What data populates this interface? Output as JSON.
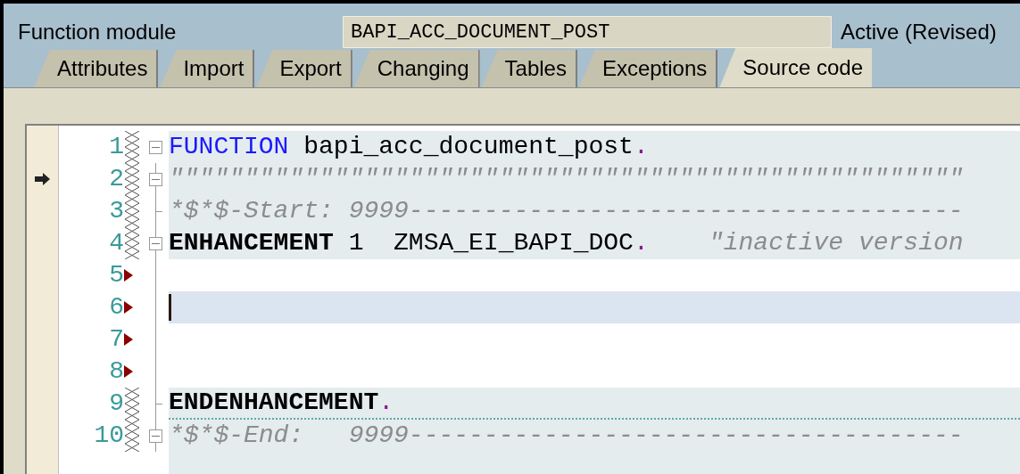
{
  "header": {
    "label": "Function module",
    "value": "BAPI_ACC_DOCUMENT_POST",
    "status": "Active (Revised)"
  },
  "tabs": [
    {
      "label": "Attributes",
      "selected": false
    },
    {
      "label": "Import",
      "selected": false
    },
    {
      "label": "Export",
      "selected": false
    },
    {
      "label": "Changing",
      "selected": false
    },
    {
      "label": "Tables",
      "selected": false
    },
    {
      "label": "Exceptions",
      "selected": false
    },
    {
      "label": "Source code",
      "selected": true
    }
  ],
  "editor": {
    "lines": [
      {
        "number": "1",
        "inserted": false,
        "collapsible": true,
        "block_end": false,
        "shaded": true,
        "current": false,
        "arrow": false,
        "tokens": [
          {
            "kind": "keyword",
            "text": "FUNCTION"
          },
          {
            "kind": "plain",
            "text": " bapi_acc_document_post"
          },
          {
            "kind": "period",
            "text": "."
          }
        ]
      },
      {
        "number": "2",
        "inserted": false,
        "collapsible": true,
        "block_end": false,
        "shaded": true,
        "current": false,
        "arrow": true,
        "tokens": [
          {
            "kind": "comment",
            "text": "\"\"\"\"\"\"\"\"\"\"\"\"\"\"\"\"\"\"\"\"\"\"\"\"\"\"\"\"\"\"\"\"\"\"\"\"\"\"\"\"\"\"\"\"\"\"\"\"\"\"\"\"\""
          }
        ]
      },
      {
        "number": "3",
        "inserted": false,
        "collapsible": false,
        "block_end": true,
        "shaded": true,
        "current": false,
        "arrow": false,
        "tokens": [
          {
            "kind": "comment",
            "text": "*$*$-Start: 9999-------------------------------------"
          }
        ]
      },
      {
        "number": "4",
        "inserted": false,
        "collapsible": true,
        "block_end": false,
        "shaded": true,
        "current": false,
        "arrow": false,
        "tokens": [
          {
            "kind": "bold",
            "text": "ENHANCEMENT"
          },
          {
            "kind": "plain",
            "text": " 1  ZMSA_EI_BAPI_DOC"
          },
          {
            "kind": "period",
            "text": "."
          },
          {
            "kind": "comment",
            "text": "    \"inactive version"
          }
        ]
      },
      {
        "number": "5",
        "inserted": true,
        "collapsible": false,
        "block_end": false,
        "shaded": false,
        "current": false,
        "arrow": false
      },
      {
        "number": "6",
        "inserted": true,
        "collapsible": false,
        "block_end": false,
        "current": true,
        "arrow": false
      },
      {
        "number": "7",
        "inserted": true,
        "collapsible": false,
        "block_end": false,
        "shaded": false,
        "current": false,
        "arrow": false
      },
      {
        "number": "8",
        "inserted": true,
        "collapsible": false,
        "block_end": false,
        "shaded": false,
        "current": false,
        "arrow": false
      },
      {
        "number": "9",
        "inserted": false,
        "collapsible": false,
        "block_end": true,
        "shaded": true,
        "current": false,
        "arrow": false,
        "tokens": [
          {
            "kind": "bold",
            "text": "ENDENHANCEMENT"
          },
          {
            "kind": "period",
            "text": "."
          }
        ]
      },
      {
        "number": "10",
        "inserted": false,
        "collapsible": true,
        "block_end": false,
        "shaded": true,
        "current": false,
        "arrow": false,
        "tokens": [
          {
            "kind": "comment",
            "text": "*$*$-End:   9999-------------------------------------"
          }
        ]
      }
    ]
  }
}
